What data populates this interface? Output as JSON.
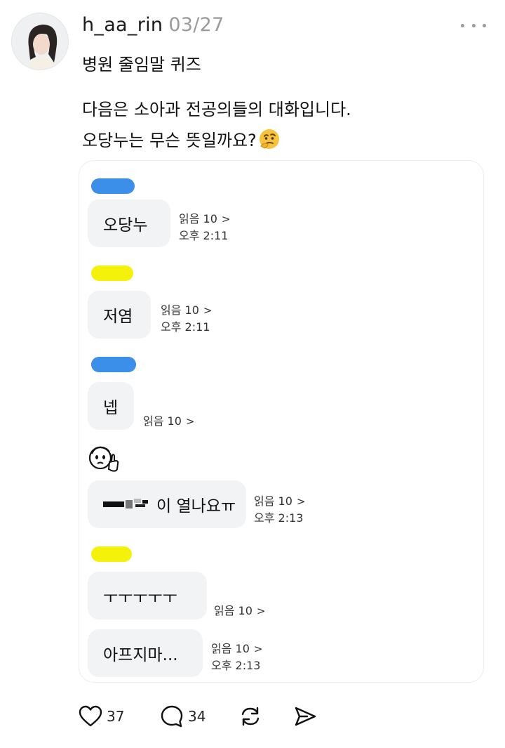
{
  "post": {
    "username": "h_aa_rin",
    "date": "03/27",
    "title": "병원 줄임말 퀴즈",
    "body_line1": "다음은 소아과 전공의들의 대화입니다.",
    "body_line2": "오당누는 무슨 뜻일까요?"
  },
  "chat": {
    "messages": [
      {
        "text": "오당누",
        "read": "읽음 10",
        "time": "오후 2:11"
      },
      {
        "text": "저염",
        "read": "읽음 10",
        "time": "오후 2:11"
      },
      {
        "text": "넵",
        "read": "읽음 10"
      },
      {
        "text": "이 열나요ㅠ",
        "read": "읽음 10",
        "time": "오후 2:13"
      },
      {
        "text": "ㅜㅜㅜㅜㅜ",
        "read": "읽음 10"
      },
      {
        "text": "아프지마...",
        "read": "읽음 10",
        "time": "오후 2:13"
      }
    ]
  },
  "actions": {
    "likes": "37",
    "comments": "34"
  },
  "colors": {
    "blue_name": "#3b8fe8",
    "yellow_name": "#f4f20a",
    "bubble": "#f2f3f5"
  }
}
